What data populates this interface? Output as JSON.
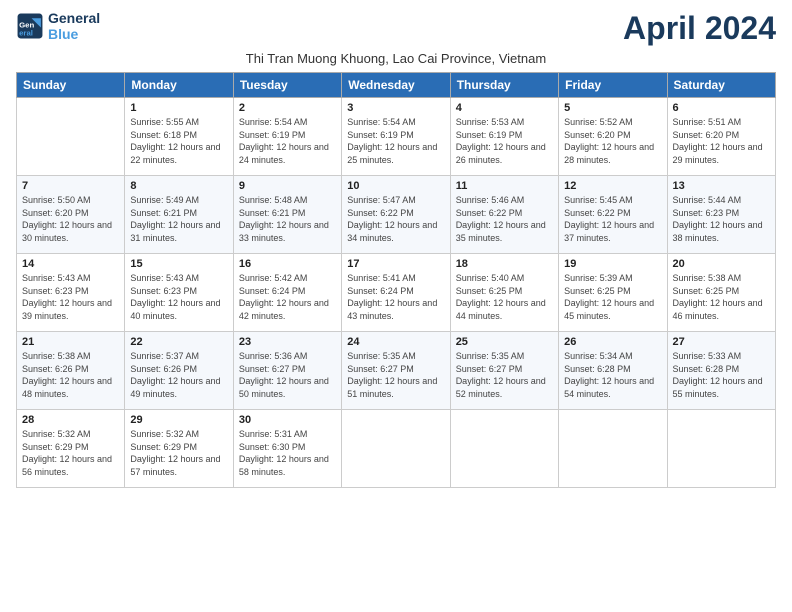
{
  "header": {
    "logo_line1": "General",
    "logo_line2": "Blue",
    "month_title": "April 2024",
    "subtitle": "Thi Tran Muong Khuong, Lao Cai Province, Vietnam"
  },
  "weekdays": [
    "Sunday",
    "Monday",
    "Tuesday",
    "Wednesday",
    "Thursday",
    "Friday",
    "Saturday"
  ],
  "weeks": [
    [
      {
        "day": "",
        "sunrise": "",
        "sunset": "",
        "daylight": ""
      },
      {
        "day": "1",
        "sunrise": "Sunrise: 5:55 AM",
        "sunset": "Sunset: 6:18 PM",
        "daylight": "Daylight: 12 hours and 22 minutes."
      },
      {
        "day": "2",
        "sunrise": "Sunrise: 5:54 AM",
        "sunset": "Sunset: 6:19 PM",
        "daylight": "Daylight: 12 hours and 24 minutes."
      },
      {
        "day": "3",
        "sunrise": "Sunrise: 5:54 AM",
        "sunset": "Sunset: 6:19 PM",
        "daylight": "Daylight: 12 hours and 25 minutes."
      },
      {
        "day": "4",
        "sunrise": "Sunrise: 5:53 AM",
        "sunset": "Sunset: 6:19 PM",
        "daylight": "Daylight: 12 hours and 26 minutes."
      },
      {
        "day": "5",
        "sunrise": "Sunrise: 5:52 AM",
        "sunset": "Sunset: 6:20 PM",
        "daylight": "Daylight: 12 hours and 28 minutes."
      },
      {
        "day": "6",
        "sunrise": "Sunrise: 5:51 AM",
        "sunset": "Sunset: 6:20 PM",
        "daylight": "Daylight: 12 hours and 29 minutes."
      }
    ],
    [
      {
        "day": "7",
        "sunrise": "Sunrise: 5:50 AM",
        "sunset": "Sunset: 6:20 PM",
        "daylight": "Daylight: 12 hours and 30 minutes."
      },
      {
        "day": "8",
        "sunrise": "Sunrise: 5:49 AM",
        "sunset": "Sunset: 6:21 PM",
        "daylight": "Daylight: 12 hours and 31 minutes."
      },
      {
        "day": "9",
        "sunrise": "Sunrise: 5:48 AM",
        "sunset": "Sunset: 6:21 PM",
        "daylight": "Daylight: 12 hours and 33 minutes."
      },
      {
        "day": "10",
        "sunrise": "Sunrise: 5:47 AM",
        "sunset": "Sunset: 6:22 PM",
        "daylight": "Daylight: 12 hours and 34 minutes."
      },
      {
        "day": "11",
        "sunrise": "Sunrise: 5:46 AM",
        "sunset": "Sunset: 6:22 PM",
        "daylight": "Daylight: 12 hours and 35 minutes."
      },
      {
        "day": "12",
        "sunrise": "Sunrise: 5:45 AM",
        "sunset": "Sunset: 6:22 PM",
        "daylight": "Daylight: 12 hours and 37 minutes."
      },
      {
        "day": "13",
        "sunrise": "Sunrise: 5:44 AM",
        "sunset": "Sunset: 6:23 PM",
        "daylight": "Daylight: 12 hours and 38 minutes."
      }
    ],
    [
      {
        "day": "14",
        "sunrise": "Sunrise: 5:43 AM",
        "sunset": "Sunset: 6:23 PM",
        "daylight": "Daylight: 12 hours and 39 minutes."
      },
      {
        "day": "15",
        "sunrise": "Sunrise: 5:43 AM",
        "sunset": "Sunset: 6:23 PM",
        "daylight": "Daylight: 12 hours and 40 minutes."
      },
      {
        "day": "16",
        "sunrise": "Sunrise: 5:42 AM",
        "sunset": "Sunset: 6:24 PM",
        "daylight": "Daylight: 12 hours and 42 minutes."
      },
      {
        "day": "17",
        "sunrise": "Sunrise: 5:41 AM",
        "sunset": "Sunset: 6:24 PM",
        "daylight": "Daylight: 12 hours and 43 minutes."
      },
      {
        "day": "18",
        "sunrise": "Sunrise: 5:40 AM",
        "sunset": "Sunset: 6:25 PM",
        "daylight": "Daylight: 12 hours and 44 minutes."
      },
      {
        "day": "19",
        "sunrise": "Sunrise: 5:39 AM",
        "sunset": "Sunset: 6:25 PM",
        "daylight": "Daylight: 12 hours and 45 minutes."
      },
      {
        "day": "20",
        "sunrise": "Sunrise: 5:38 AM",
        "sunset": "Sunset: 6:25 PM",
        "daylight": "Daylight: 12 hours and 46 minutes."
      }
    ],
    [
      {
        "day": "21",
        "sunrise": "Sunrise: 5:38 AM",
        "sunset": "Sunset: 6:26 PM",
        "daylight": "Daylight: 12 hours and 48 minutes."
      },
      {
        "day": "22",
        "sunrise": "Sunrise: 5:37 AM",
        "sunset": "Sunset: 6:26 PM",
        "daylight": "Daylight: 12 hours and 49 minutes."
      },
      {
        "day": "23",
        "sunrise": "Sunrise: 5:36 AM",
        "sunset": "Sunset: 6:27 PM",
        "daylight": "Daylight: 12 hours and 50 minutes."
      },
      {
        "day": "24",
        "sunrise": "Sunrise: 5:35 AM",
        "sunset": "Sunset: 6:27 PM",
        "daylight": "Daylight: 12 hours and 51 minutes."
      },
      {
        "day": "25",
        "sunrise": "Sunrise: 5:35 AM",
        "sunset": "Sunset: 6:27 PM",
        "daylight": "Daylight: 12 hours and 52 minutes."
      },
      {
        "day": "26",
        "sunrise": "Sunrise: 5:34 AM",
        "sunset": "Sunset: 6:28 PM",
        "daylight": "Daylight: 12 hours and 54 minutes."
      },
      {
        "day": "27",
        "sunrise": "Sunrise: 5:33 AM",
        "sunset": "Sunset: 6:28 PM",
        "daylight": "Daylight: 12 hours and 55 minutes."
      }
    ],
    [
      {
        "day": "28",
        "sunrise": "Sunrise: 5:32 AM",
        "sunset": "Sunset: 6:29 PM",
        "daylight": "Daylight: 12 hours and 56 minutes."
      },
      {
        "day": "29",
        "sunrise": "Sunrise: 5:32 AM",
        "sunset": "Sunset: 6:29 PM",
        "daylight": "Daylight: 12 hours and 57 minutes."
      },
      {
        "day": "30",
        "sunrise": "Sunrise: 5:31 AM",
        "sunset": "Sunset: 6:30 PM",
        "daylight": "Daylight: 12 hours and 58 minutes."
      },
      {
        "day": "",
        "sunrise": "",
        "sunset": "",
        "daylight": ""
      },
      {
        "day": "",
        "sunrise": "",
        "sunset": "",
        "daylight": ""
      },
      {
        "day": "",
        "sunrise": "",
        "sunset": "",
        "daylight": ""
      },
      {
        "day": "",
        "sunrise": "",
        "sunset": "",
        "daylight": ""
      }
    ]
  ]
}
